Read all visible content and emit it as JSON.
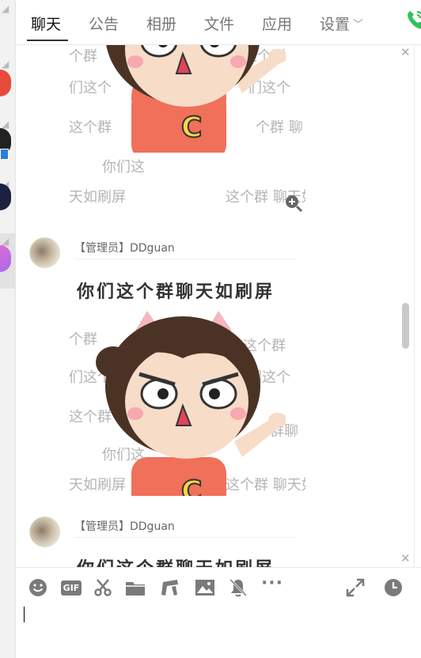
{
  "tabs": [
    {
      "label": "聊天",
      "active": true
    },
    {
      "label": "公告"
    },
    {
      "label": "相册"
    },
    {
      "label": "文件"
    },
    {
      "label": "应用"
    },
    {
      "label": "设置"
    }
  ],
  "messages": [
    {
      "sender": "【管理员】DDguan",
      "sticker": {
        "caption": "你们这个群聊天如刷屏",
        "bg_rows": [
          "个群",
          "这个群",
          "们这个",
          "们这个",
          "这个群",
          "个群聊",
          "你们这",
          "天如刷屏",
          "这个群 聊天如"
        ]
      }
    },
    {
      "sender": "【管理员】DDguan",
      "sticker": {
        "caption": "你们这个群聊天如刷屏"
      }
    }
  ],
  "toolbar": {
    "gif_label": "GIF",
    "more_label": "···"
  },
  "input": {
    "value": "",
    "placeholder": ""
  },
  "colors": {
    "accent_green": "#2fc25b",
    "shirt": "#f0705a",
    "hair": "#4a3325"
  },
  "icons": [
    "emoji-icon",
    "gif-icon",
    "scissors-icon",
    "folder-icon",
    "music-icon",
    "image-icon",
    "mute-bell-icon",
    "more-icon",
    "expand-icon",
    "history-clock-icon",
    "phone-icon",
    "zoom-icon",
    "close-icon"
  ]
}
